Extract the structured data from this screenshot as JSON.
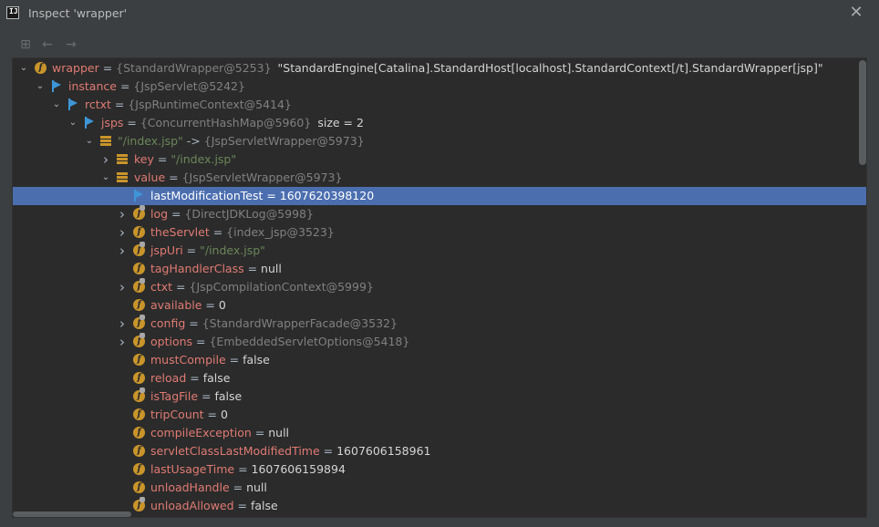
{
  "window": {
    "title": "Inspect 'wrapper'",
    "app_icon_label": "IJ",
    "close_glyph": "✕"
  },
  "toolbar": {
    "tree_glyph": "⊞",
    "back_glyph": "←",
    "forward_glyph": "→"
  },
  "glyphs": {
    "expanded": "⌄",
    "collapsed": "›",
    "field": "f"
  },
  "colors": {
    "accent": "#4b6eaf",
    "field": "#c9952b",
    "flag": "#3e95d6",
    "string": "#6a8759",
    "name": "#e07b73"
  },
  "rows": [
    {
      "level": 0,
      "arrow": "expanded",
      "icon": "field",
      "name": "wrapper",
      "obj": "{StandardWrapper@5253}",
      "value": "\"StandardEngine[Catalina].StandardHost[localhost].StandardContext[/t].StandardWrapper[jsp]\"",
      "value_type": "val"
    },
    {
      "level": 1,
      "arrow": "expanded",
      "icon": "flag",
      "name": "instance",
      "obj": "{JspServlet@5242}"
    },
    {
      "level": 2,
      "arrow": "expanded",
      "icon": "flag",
      "name": "rctxt",
      "obj": "{JspRuntimeContext@5414}"
    },
    {
      "level": 3,
      "arrow": "expanded",
      "icon": "flag",
      "name": "jsps",
      "obj": "{ConcurrentHashMap@5960}",
      "value": "size = 2",
      "value_type": "val"
    },
    {
      "level": 4,
      "arrow": "expanded",
      "icon": "entry",
      "name": "\"/index.jsp\"",
      "name_type": "str",
      "eq": " -> ",
      "obj": "{JspServletWrapper@5973}"
    },
    {
      "level": 5,
      "arrow": "collapsed",
      "icon": "entry",
      "name": "key",
      "value": "\"/index.jsp\"",
      "value_type": "str"
    },
    {
      "level": 5,
      "arrow": "expanded",
      "icon": "entry",
      "name": "value",
      "obj": "{JspServletWrapper@5973}"
    },
    {
      "level": 6,
      "arrow": "none",
      "icon": "flag",
      "name": "lastModificationTest",
      "value": "1607620398120",
      "value_type": "val",
      "selected": true
    },
    {
      "level": 6,
      "arrow": "collapsed",
      "icon": "field-lock",
      "name": "log",
      "obj": "{DirectJDKLog@5998}"
    },
    {
      "level": 6,
      "arrow": "collapsed",
      "icon": "field",
      "name": "theServlet",
      "obj": "{index_jsp@3523}"
    },
    {
      "level": 6,
      "arrow": "collapsed",
      "icon": "field-lock",
      "name": "jspUri",
      "value": "\"/index.jsp\"",
      "value_type": "str"
    },
    {
      "level": 6,
      "arrow": "none",
      "icon": "field",
      "name": "tagHandlerClass",
      "value": "null",
      "value_type": "val"
    },
    {
      "level": 6,
      "arrow": "collapsed",
      "icon": "field-lock",
      "name": "ctxt",
      "obj": "{JspCompilationContext@5999}"
    },
    {
      "level": 6,
      "arrow": "none",
      "icon": "field",
      "name": "available",
      "value": "0",
      "value_type": "val"
    },
    {
      "level": 6,
      "arrow": "collapsed",
      "icon": "field-lock",
      "name": "config",
      "obj": "{StandardWrapperFacade@3532}"
    },
    {
      "level": 6,
      "arrow": "collapsed",
      "icon": "field-lock",
      "name": "options",
      "obj": "{EmbeddedServletOptions@5418}"
    },
    {
      "level": 6,
      "arrow": "none",
      "icon": "field",
      "name": "mustCompile",
      "value": "false",
      "value_type": "val"
    },
    {
      "level": 6,
      "arrow": "none",
      "icon": "field",
      "name": "reload",
      "value": "false",
      "value_type": "val"
    },
    {
      "level": 6,
      "arrow": "none",
      "icon": "field-lock",
      "name": "isTagFile",
      "value": "false",
      "value_type": "val"
    },
    {
      "level": 6,
      "arrow": "none",
      "icon": "field",
      "name": "tripCount",
      "value": "0",
      "value_type": "val"
    },
    {
      "level": 6,
      "arrow": "none",
      "icon": "field",
      "name": "compileException",
      "value": "null",
      "value_type": "val"
    },
    {
      "level": 6,
      "arrow": "none",
      "icon": "field",
      "name": "servletClassLastModifiedTime",
      "value": "1607606158961",
      "value_type": "val"
    },
    {
      "level": 6,
      "arrow": "none",
      "icon": "field",
      "name": "lastUsageTime",
      "value": "1607606159894",
      "value_type": "val"
    },
    {
      "level": 6,
      "arrow": "none",
      "icon": "field",
      "name": "unloadHandle",
      "value": "null",
      "value_type": "val"
    },
    {
      "level": 6,
      "arrow": "none",
      "icon": "field-lock",
      "name": "unloadAllowed",
      "value": "false",
      "value_type": "val"
    }
  ]
}
